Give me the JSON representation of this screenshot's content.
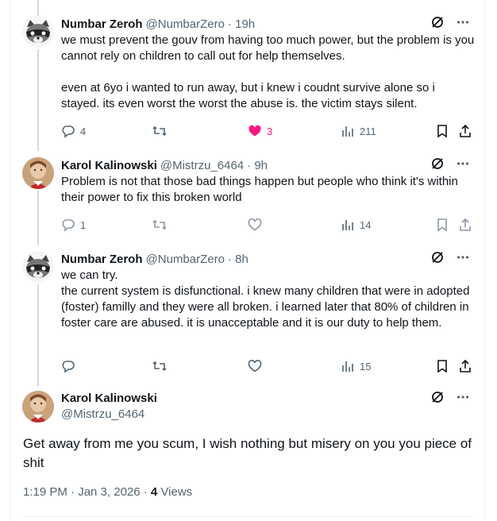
{
  "replies": [
    {
      "name": "Numbar Zeroh",
      "handle": "@NumbarZero",
      "time": "· 19h",
      "avatar": "raccoon-avatar",
      "text": "we must prevent the gouv from having too much power, but the problem is you cannot rely on children to call out for help themselves.\n\neven at 6yo i wanted to run away, but i knew i coudnt survive alone so i stayed. its even worst the worst the abuse is. the victim stays silent.",
      "replies_count": "4",
      "reposts_count": "",
      "likes_count": "3",
      "liked": true,
      "views_count": "211"
    },
    {
      "name": "Karol Kalinowski",
      "handle": "@Mistrzu_6464",
      "time": "· 9h",
      "avatar": "person-avatar",
      "text": "Problem is not that those bad things happen but people who think it's within their power to fix this broken world",
      "replies_count": "1",
      "reposts_count": "",
      "likes_count": "",
      "liked": false,
      "views_count": "14"
    },
    {
      "name": "Numbar Zeroh",
      "handle": "@NumbarZero",
      "time": "· 8h",
      "avatar": "raccoon-avatar",
      "text": "we can try.\nthe current system is disfunctional. i knew many children that were in adopted (foster) familly and they were all broken. i learned later that 80% of children in foster care are abused. it is unacceptable and it is our duty to help them.",
      "replies_count": "",
      "reposts_count": "",
      "likes_count": "",
      "liked": false,
      "views_count": "15"
    }
  ],
  "main_tweet": {
    "name": "Karol Kalinowski",
    "handle": "@Mistrzu_6464",
    "avatar": "person-avatar",
    "text": "Get away from me you scum, I wish nothing but misery on you you piece of shit",
    "timestamp": "1:19 PM · Jan 3, 2026 · ",
    "views_count": "4",
    "views_label": " Views"
  },
  "colors": {
    "text": "#0f1419",
    "secondary": "#536471",
    "like": "#f91880",
    "border": "#eff3f4",
    "thread_line": "#cfd9de"
  },
  "icons": [
    "grok-icon",
    "more-icon",
    "reply-icon",
    "repost-icon",
    "like-icon",
    "views-icon",
    "bookmark-icon",
    "share-icon"
  ]
}
